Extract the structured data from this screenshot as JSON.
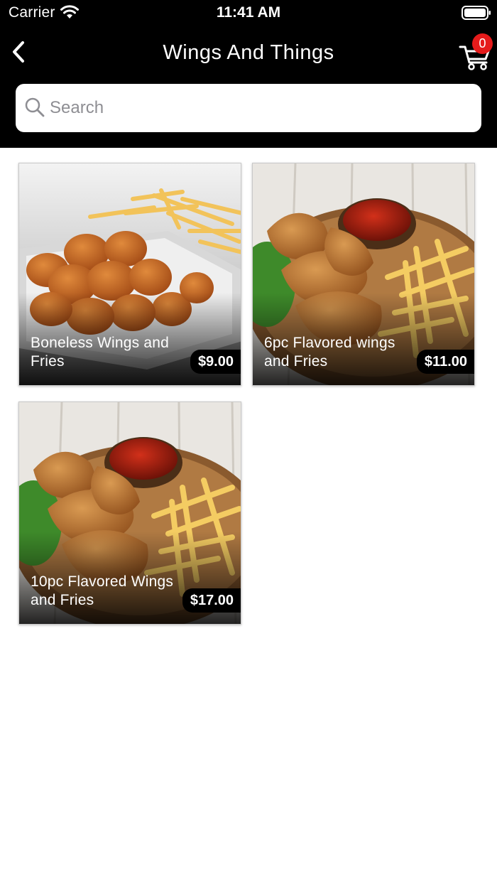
{
  "status": {
    "carrier": "Carrier",
    "time": "11:41 AM"
  },
  "nav": {
    "title": "Wings And Things",
    "cart_count": "0"
  },
  "search": {
    "placeholder": "Search",
    "value": ""
  },
  "colors": {
    "header_bg": "#000000",
    "badge": "#e51b1b",
    "page_bg": "#ffffff"
  },
  "products": [
    {
      "name": "Boneless Wings and Fries",
      "price": "$9.00"
    },
    {
      "name": "6pc Flavored wings and Fries",
      "price": "$11.00"
    },
    {
      "name": "10pc Flavored Wings and Fries",
      "price": "$17.00"
    }
  ]
}
